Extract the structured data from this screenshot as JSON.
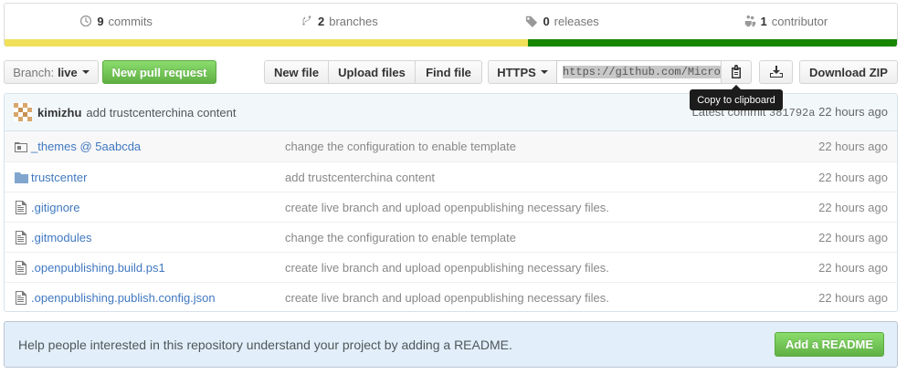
{
  "summary": {
    "commits": {
      "count": "9",
      "label": "commits"
    },
    "branches": {
      "count": "2",
      "label": "branches"
    },
    "releases": {
      "count": "0",
      "label": "releases"
    },
    "contributors": {
      "count": "1",
      "label": "contributor"
    }
  },
  "language_bar": [
    {
      "share": 0.586,
      "color": "#f1e05a"
    },
    {
      "share": 0.414,
      "color": "#178600"
    }
  ],
  "toolbar": {
    "branch_label": "Branch:",
    "branch_value": "live",
    "new_pull_request": "New pull request",
    "new_file": "New file",
    "upload_files": "Upload files",
    "find_file": "Find file",
    "protocol": "HTTPS",
    "clone_url": "https://github.com/Micros",
    "download_zip": "Download ZIP",
    "tooltip": "Copy to clipboard"
  },
  "latest_commit": {
    "author": "kimizhu",
    "message": "add trustcenterchina content",
    "label": "Latest commit",
    "sha": "381792a",
    "age": "22 hours ago"
  },
  "files": [
    {
      "name": "_themes @ 5aabcda",
      "type": "submodule",
      "message": "change the configuration to enable template",
      "age": "22 hours ago"
    },
    {
      "name": "trustcenter",
      "type": "folder",
      "message": "add trustcenterchina content",
      "age": "22 hours ago"
    },
    {
      "name": ".gitignore",
      "type": "file",
      "message": "create live branch and upload openpublishing necessary files.",
      "age": "22 hours ago"
    },
    {
      "name": ".gitmodules",
      "type": "file",
      "message": "change the configuration to enable template",
      "age": "22 hours ago"
    },
    {
      "name": ".openpublishing.build.ps1",
      "type": "file",
      "message": "create live branch and upload openpublishing necessary files.",
      "age": "22 hours ago"
    },
    {
      "name": ".openpublishing.publish.config.json",
      "type": "file",
      "message": "create live branch and upload openpublishing necessary files.",
      "age": "22 hours ago"
    }
  ],
  "readme_prompt": {
    "text": "Help people interested in this repository understand your project by adding a README.",
    "button": "Add a README"
  }
}
